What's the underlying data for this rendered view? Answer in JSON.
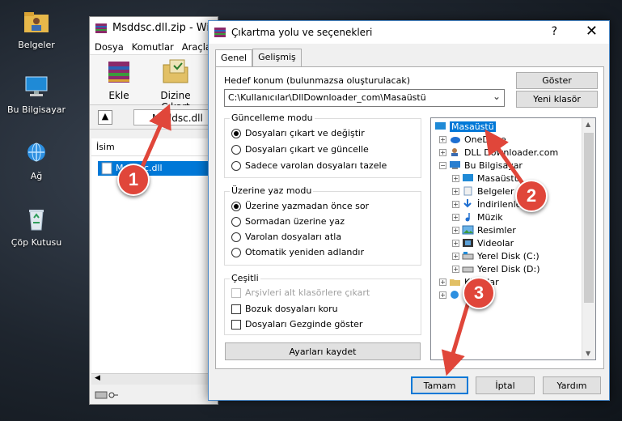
{
  "desktop": {
    "icons": [
      {
        "label": "Belgeler"
      },
      {
        "label": "Bu Bilgisayar"
      },
      {
        "label": "Ağ"
      },
      {
        "label": "Çöp Kutusu"
      }
    ]
  },
  "winrar": {
    "title": "Msddsc.dll.zip - Win",
    "menu": [
      "Dosya",
      "Komutlar",
      "Araçla"
    ],
    "toolbar": {
      "add_label": "Ekle",
      "extract_label": "Dizine Çıkart"
    },
    "path": "Msddsc.dll",
    "list_header": "İsim",
    "file_name": "Msddsc.dll"
  },
  "dialog": {
    "title": "Çıkartma yolu ve seçenekleri",
    "help": "?",
    "close": "✕",
    "tabs": [
      {
        "label": "Genel"
      },
      {
        "label": "Gelişmiş"
      }
    ],
    "dest_label": "Hedef konum (bulunmazsa oluşturulacak)",
    "dest_value": "C:\\Kullanıcılar\\DllDownloader_com\\Masaüstü",
    "show_button": "Göster",
    "new_folder_button": "Yeni klasör",
    "update_mode": {
      "title": "Güncelleme modu",
      "options": [
        "Dosyaları çıkart ve değiştir",
        "Dosyaları çıkart ve güncelle",
        "Sadece varolan dosyaları tazele"
      ]
    },
    "overwrite_mode": {
      "title": "Üzerine yaz modu",
      "options": [
        "Üzerine yazmadan önce sor",
        "Sormadan üzerine yaz",
        "Varolan dosyaları atla",
        "Otomatik yeniden adlandır"
      ]
    },
    "misc": {
      "title": "Çeşitli",
      "options": [
        "Arşivleri alt klasörlere çıkart",
        "Bozuk dosyaları koru",
        "Dosyaları Gezginde göster"
      ]
    },
    "save_settings_button": "Ayarları kaydet",
    "tree": [
      "Masaüstü",
      "OneDrive",
      "DLL Downloader.com",
      "Bu Bilgisayar",
      "Masaüstü",
      "Belgeler",
      "İndirilenler",
      "Müzik",
      "Resimler",
      "Videolar",
      "Yerel Disk (C:)",
      "Yerel Disk (D:)",
      "Kitaplar",
      "Ağ"
    ],
    "ok_button": "Tamam",
    "cancel_button": "İptal",
    "help_button": "Yardım"
  },
  "annotations": [
    "1",
    "2",
    "3"
  ],
  "colors": {
    "accent": "#0078d7",
    "badge": "#e0463a"
  }
}
